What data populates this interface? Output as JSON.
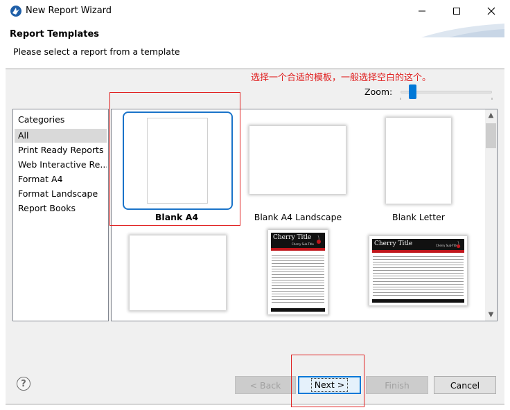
{
  "window": {
    "title": "New Report Wizard",
    "icon": "birt-app-icon"
  },
  "header": {
    "title": "Report Templates",
    "description": "Please select a report from a template"
  },
  "annotation": {
    "text": "选择一个合适的模板，一般选择空白的这个。",
    "color": "#e02020"
  },
  "zoom": {
    "label": "Zoom:",
    "level": 0.1
  },
  "categories": {
    "heading": "Categories",
    "items": [
      {
        "label": "All",
        "selected": true
      },
      {
        "label": "Print Ready Reports",
        "selected": false
      },
      {
        "label": "Web Interactive Re...",
        "selected": false
      },
      {
        "label": "Format A4",
        "selected": false
      },
      {
        "label": "Format Landscape",
        "selected": false
      },
      {
        "label": "Report Books",
        "selected": false
      }
    ]
  },
  "templates": [
    {
      "label": "Blank A4",
      "selected": true
    },
    {
      "label": "Blank A4 Landscape",
      "selected": false
    },
    {
      "label": "Blank Letter",
      "selected": false
    },
    {
      "label": "",
      "selected": false
    },
    {
      "label": "",
      "selected": false,
      "preview_title": "Cherry Title",
      "preview_subtitle": "Cherry Sub-Title"
    },
    {
      "label": "",
      "selected": false,
      "preview_title": "Cherry Title",
      "preview_subtitle": "Cherry Sub-Title"
    }
  ],
  "footer": {
    "help_icon": "question-mark-icon",
    "back_label": "< Back",
    "next_label": "Next >",
    "finish_label": "Finish",
    "cancel_label": "Cancel"
  },
  "colors": {
    "selection_border": "#1a73c9",
    "accent": "#0078d7",
    "annotation_red": "#e02020",
    "cherry_red": "#c0161b"
  }
}
